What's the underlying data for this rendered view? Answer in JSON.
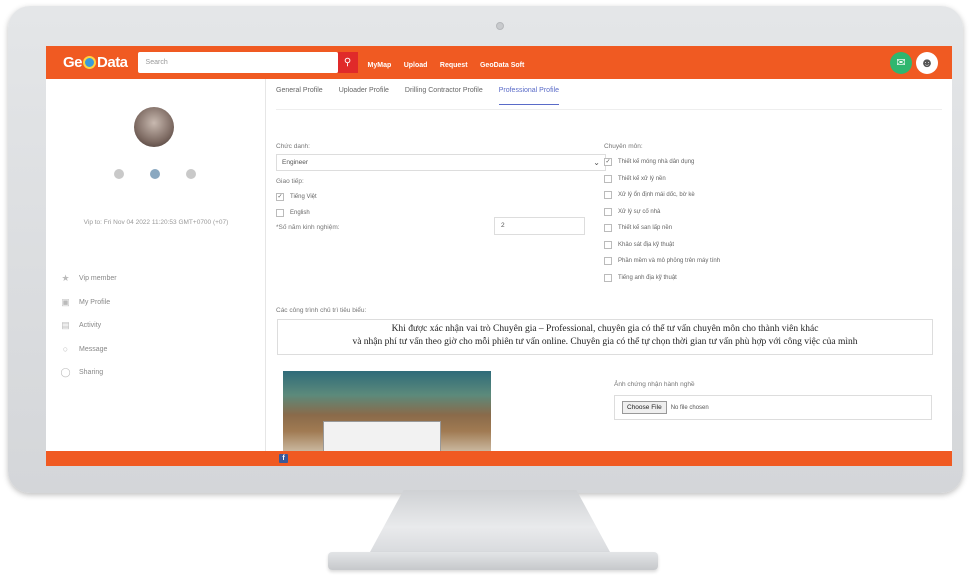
{
  "header": {
    "logo": "GeoData",
    "search_placeholder": "Search",
    "nav": [
      "MyMap",
      "Upload",
      "Request",
      "GeoData Soft"
    ]
  },
  "sidebar": {
    "vip_text": "Vip to: Fri Nov 04 2022 11:20:53 GMT+0700 (+07)",
    "menu": [
      {
        "label": "Vip member",
        "icon": "star-icon"
      },
      {
        "label": "My Profile",
        "icon": "profile-icon"
      },
      {
        "label": "Activity",
        "icon": "activity-icon"
      },
      {
        "label": "Message",
        "icon": "message-icon"
      },
      {
        "label": "Sharing",
        "icon": "sharing-icon"
      }
    ]
  },
  "tabs": [
    "General Profile",
    "Uploader Profile",
    "Drilling Contractor Profile",
    "Professional Profile"
  ],
  "active_tab": "Professional Profile",
  "form": {
    "title_label": "Chức danh:",
    "title_value": "Engineer",
    "lang_label": "Giao tiếp:",
    "langs": [
      {
        "label": "Tiếng Việt",
        "checked": true
      },
      {
        "label": "English",
        "checked": false
      }
    ],
    "years_label": "*Số năm kinh nghiệm:",
    "years_value": "2",
    "specialty_label": "Chuyên môn:",
    "specialties": [
      {
        "label": "Thiết kế móng nhà dân dụng",
        "checked": true
      },
      {
        "label": "Thiết kế xử lý nền",
        "checked": false
      },
      {
        "label": "Xử lý ổn định mái dốc, bờ kè",
        "checked": false
      },
      {
        "label": "Xử lý sự cố nhà",
        "checked": false
      },
      {
        "label": "Thiết kế san lấp nền",
        "checked": false
      },
      {
        "label": "Khảo sát địa kỹ thuật",
        "checked": false
      },
      {
        "label": "Phần mềm và mô phỏng trên máy tính",
        "checked": false
      },
      {
        "label": "Tiếng anh địa kỹ thuật",
        "checked": false
      }
    ],
    "projects_label": "Các công trình chủ trì tiêu biểu:",
    "projects_text_1": "Khi được xác nhận vai trò Chuyên gia – Professional, chuyên gia có thể tư vấn chuyên môn cho thành viên khác",
    "projects_text_2": "và nhận phí tư vấn theo giờ cho mỗi phiên tư vấn online. Chuyên gia có thể tự chọn thời gian tư vấn phù hợp với công việc của mình",
    "cert_label": "Ảnh chứng nhận hành nghề",
    "file_button": "Choose File",
    "file_status": "No file chosen"
  },
  "colors": {
    "brand": "#f05a22",
    "accent": "#5a6bc8"
  }
}
